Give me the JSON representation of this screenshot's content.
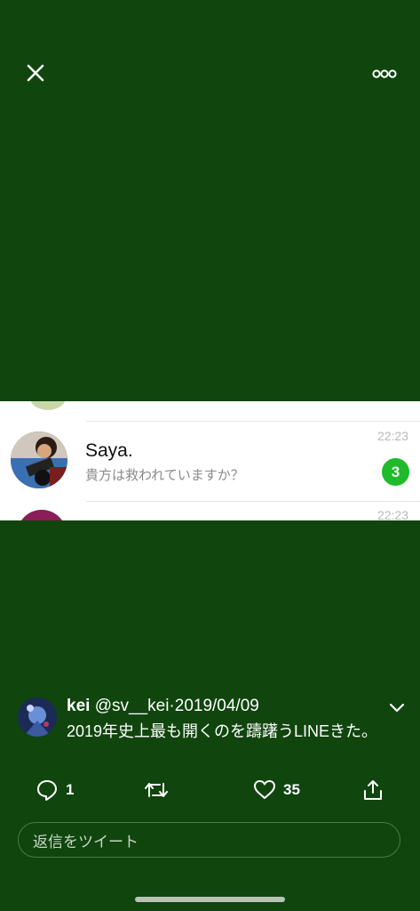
{
  "colors": {
    "background": "#10450e",
    "line_badge": "#1fbb2a",
    "text": "#ffffff"
  },
  "top_bar": {
    "close_icon": "close-icon",
    "more_icon": "more-options-icon"
  },
  "embedded_image": {
    "chat": {
      "name": "Saya.",
      "preview": "貴方は救われていますか？",
      "time": "22:23",
      "unread_count": "3",
      "next_time": "22:23"
    }
  },
  "tweet": {
    "author": "kei",
    "handle": "@sv__kei",
    "separator": "·",
    "date": "2019/04/09",
    "text": "2019年史上最も開くのを躊躇うLINEきた。",
    "reply_count": "1",
    "retweet_count": "",
    "like_count": "35"
  },
  "reply_box": {
    "placeholder": "返信をツイート"
  }
}
